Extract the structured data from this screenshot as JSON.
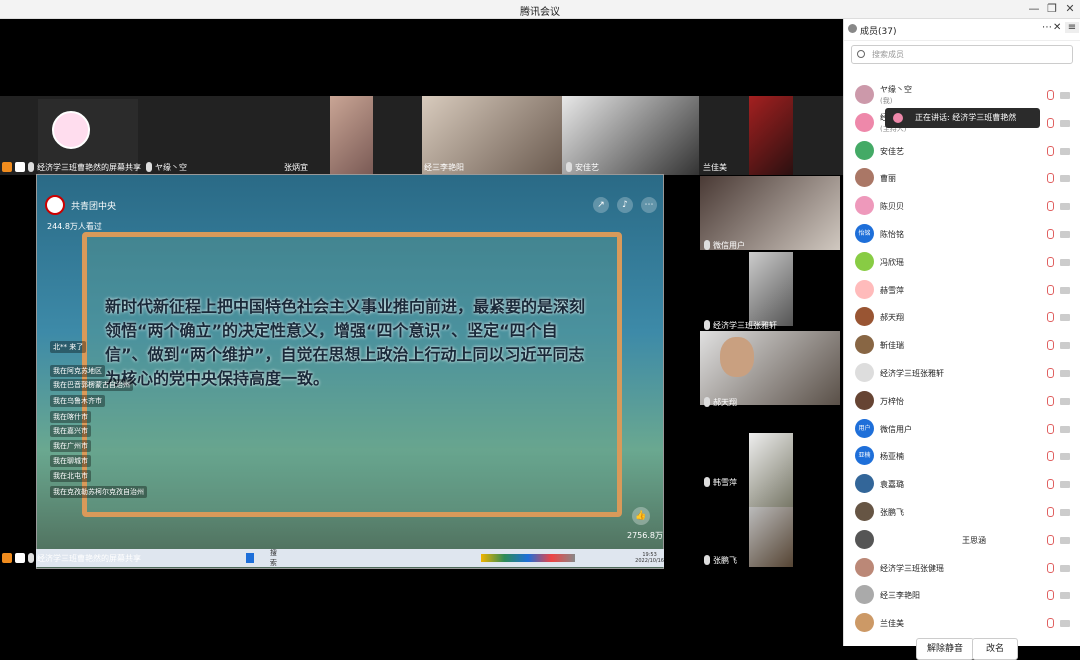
{
  "window": {
    "title": "腾讯会议",
    "minimize": "—",
    "restore": "❐",
    "close": "✕"
  },
  "share_top_label": "经济学三班曹艳然的屏幕共享",
  "share_bottom_label": "经济学三班曹艳然的屏幕共享",
  "tiles": {
    "t1": "ヤ缘丶空",
    "t2": "张炳宜",
    "t3": "经三李艳阳",
    "t4": "安佳艺",
    "t5": "兰佳美",
    "r1": "微信用户",
    "r2": "经济学三班张雅轩",
    "r3": "郝天翔",
    "r4": "韩雪萍",
    "r5": "张鹏飞"
  },
  "video": {
    "channel": "共青团中央",
    "views": "244.8万人看过",
    "headline": "新时代新征程上把中国特色社会主义事业推向前进，最紧要的是深刻领悟“两个确立”的决定性意义，增强“四个意识”、坚定“四个自信”、做到“两个维护”，自觉在思想上政治上行动上同以习近平同志为核心的党中央保持高度一致。",
    "likes": "2756.8万",
    "comments": [
      "北** 来了",
      "我在阿克苏地区",
      "我在巴音郭楞蒙古自治州",
      "我在乌鲁木齐市",
      "我在喀什市",
      "我在嘉兴市",
      "我在广州市",
      "我在聊城市",
      "我在北屯市",
      "我在克孜勒苏柯尔克孜自治州"
    ],
    "taskbar_search": "搜索",
    "taskbar_time": "19:53",
    "taskbar_date": "2022/10/16"
  },
  "panel": {
    "title": "成员(37)",
    "search_placeholder": "搜索成员",
    "speaking": "正在讲话: 经济学三班曹艳然",
    "members": [
      {
        "name": "ヤ缘丶空",
        "sub": "(我)",
        "avatar": "",
        "color": "#c9a"
      },
      {
        "name": "经济学三班曹艳然",
        "sub": "(主持人)",
        "avatar": "",
        "color": "#e8a"
      },
      {
        "name": "安佳艺",
        "avatar": "",
        "color": "#4a6"
      },
      {
        "name": "曹丽",
        "avatar": "",
        "color": "#a76"
      },
      {
        "name": "陈贝贝",
        "avatar": "",
        "color": "#e9b"
      },
      {
        "name": "陈怡铭",
        "avatar": "怡铭",
        "color": "#1e6fd9"
      },
      {
        "name": "冯欣瑶",
        "avatar": "",
        "color": "#8c4"
      },
      {
        "name": "赫雪萍",
        "avatar": "",
        "color": "#fbb"
      },
      {
        "name": "郝天翔",
        "avatar": "",
        "color": "#953"
      },
      {
        "name": "靳佳瑞",
        "avatar": "",
        "color": "#864"
      },
      {
        "name": "经济学三班张雅轩",
        "avatar": "",
        "color": "#ddd"
      },
      {
        "name": "万梓怡",
        "avatar": "",
        "color": "#643"
      },
      {
        "name": "微信用户",
        "avatar": "用户",
        "color": "#1e6fd9"
      },
      {
        "name": "杨亚楠",
        "avatar": "亚楠",
        "color": "#1e6fd9"
      },
      {
        "name": "袁嘉璐",
        "avatar": "",
        "color": "#369"
      },
      {
        "name": "张鹏飞",
        "avatar": "",
        "color": "#654"
      },
      {
        "name": "王思涵",
        "avatar": "",
        "color": "#555"
      },
      {
        "name": "经济学三班张健瑶",
        "avatar": "",
        "color": "#b87"
      },
      {
        "name": "经三李艳阳",
        "avatar": "",
        "color": "#aaa"
      },
      {
        "name": "兰佳美",
        "avatar": "",
        "color": "#c96"
      }
    ],
    "mute_all": "解除静音",
    "rename": "改名"
  }
}
